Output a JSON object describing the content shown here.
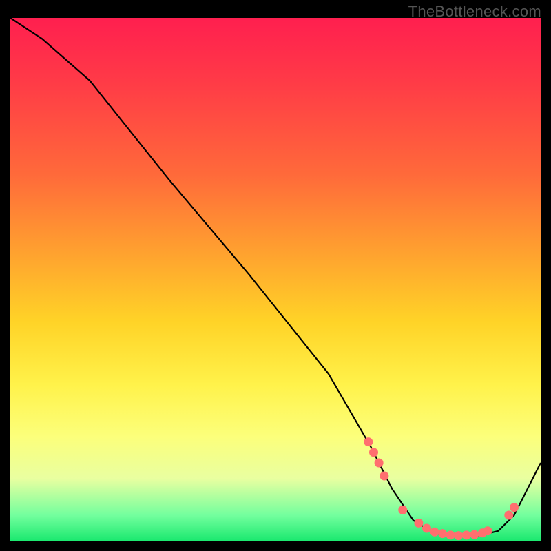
{
  "watermark": "TheBottleneck.com",
  "chart_data": {
    "type": "line",
    "title": "",
    "xlabel": "",
    "ylabel": "",
    "xlim": [
      0,
      100
    ],
    "ylim": [
      0,
      100
    ],
    "series": [
      {
        "name": "curve",
        "x": [
          0,
          6,
          15,
          30,
          45,
          60,
          68,
          72,
          76,
          80,
          84,
          88,
          92,
          95,
          100
        ],
        "y": [
          100,
          96,
          88,
          69,
          51,
          32,
          18,
          10,
          4,
          1.5,
          1,
          1,
          2,
          5,
          15
        ]
      }
    ],
    "markers": {
      "name": "highlighted-points",
      "color": "#ff6f6f",
      "points": [
        {
          "x": 67.5,
          "y": 19
        },
        {
          "x": 68.5,
          "y": 17
        },
        {
          "x": 69.5,
          "y": 15
        },
        {
          "x": 70.5,
          "y": 12.5
        },
        {
          "x": 74,
          "y": 6
        },
        {
          "x": 77,
          "y": 3.5
        },
        {
          "x": 78.5,
          "y": 2.5
        },
        {
          "x": 80,
          "y": 1.8
        },
        {
          "x": 81.5,
          "y": 1.5
        },
        {
          "x": 83,
          "y": 1.2
        },
        {
          "x": 84.5,
          "y": 1.1
        },
        {
          "x": 86,
          "y": 1.2
        },
        {
          "x": 87.5,
          "y": 1.3
        },
        {
          "x": 89,
          "y": 1.6
        },
        {
          "x": 90,
          "y": 2.0
        },
        {
          "x": 94,
          "y": 5
        },
        {
          "x": 95,
          "y": 6.5
        }
      ]
    }
  }
}
